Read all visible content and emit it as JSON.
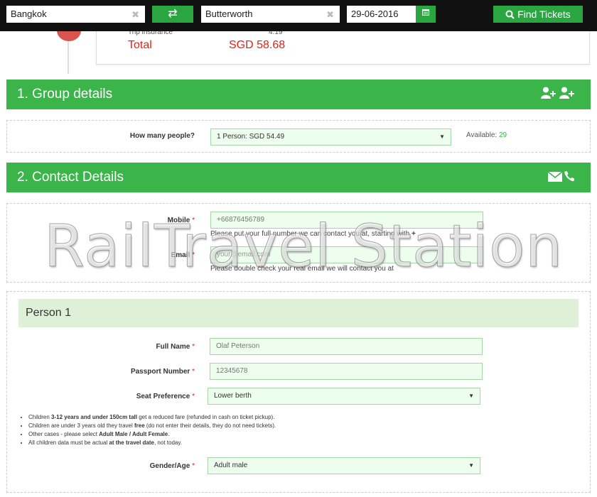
{
  "topbar": {
    "from": "Bangkok",
    "to": "Butterworth",
    "date": "29-06-2016",
    "clear_glyph": "✖",
    "swap_glyph": "⇄",
    "find_label": "Find Tickets",
    "icons": [
      "swap-icon",
      "calendar-icon",
      "search-icon"
    ]
  },
  "summary": {
    "insurance_label": "Trip insurance",
    "insurance_value": "4.19",
    "total_label": "Total",
    "total_value": "SGD 58.68"
  },
  "group": {
    "title": "1. Group details",
    "icons": [
      "add-user-icon",
      "add-user-icon"
    ],
    "people_label": "How many people?",
    "people_value": "1 Person: SGD 54.49",
    "available_label": "Available:",
    "available_value": "29"
  },
  "contact": {
    "title": "2. Contact Details",
    "icons": [
      "envelope-icon",
      "phone-icon"
    ],
    "mobile_label": "Mobile",
    "mobile_value": "+66876456789",
    "mobile_hint": "Please put your full number we can contact you at, starting with",
    "mobile_hint_plus": "+",
    "email_label": "Email",
    "email_placeholder": "your@email.com",
    "email_hint": "Please double check your real email we will contact you at"
  },
  "watermark": "RailTravel Station",
  "person": {
    "title": "Person 1",
    "fullname_label": "Full Name",
    "fullname_value": "Olaf Peterson",
    "passport_label": "Passport Number",
    "passport_value": "12345678",
    "seat_label": "Seat Preference",
    "seat_value": "Lower berth",
    "gender_label": "Gender/Age",
    "gender_value": "Adult male",
    "notes": {
      "n1_a": "Children ",
      "n1_b": "3-12 years and under 150cm tall",
      "n1_c": " get a reduced fare (refunded in cash on ticket pickup).",
      "n2_a": "Children are under 3 years old they travel ",
      "n2_b": "free",
      "n2_c": " (do not enter their details, they do not need tickets).",
      "n3_a": "Other cases - please select ",
      "n3_b": "Adult Male / Adult Female",
      "n3_c": ".",
      "n4_a": "All children data must be actual ",
      "n4_b": "at the travel date",
      "n4_c": ", not today."
    }
  },
  "required_marker": "*",
  "colors": {
    "accent": "#3bb54a",
    "total": "#e2231a",
    "input_bg": "#edfdee"
  }
}
